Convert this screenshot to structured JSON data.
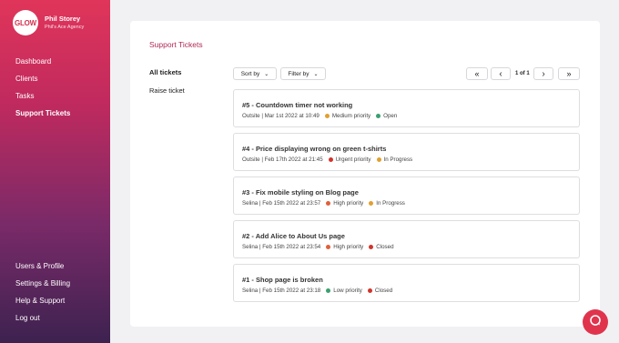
{
  "brand": {
    "logo_text": "GLOW",
    "user_name": "Phil Storey",
    "agency": "Phil's Ace Agency"
  },
  "nav_top": [
    {
      "label": "Dashboard"
    },
    {
      "label": "Clients"
    },
    {
      "label": "Tasks"
    },
    {
      "label": "Support Tickets",
      "active": true
    }
  ],
  "nav_bottom": [
    {
      "label": "Users & Profile"
    },
    {
      "label": "Settings & Billing"
    },
    {
      "label": "Help & Support"
    },
    {
      "label": "Log out"
    }
  ],
  "main": {
    "title": "Support Tickets",
    "subnav": [
      {
        "label": "All tickets",
        "active": true
      },
      {
        "label": "Raise ticket"
      }
    ],
    "sort_label": "Sort by",
    "filter_label": "Filter by",
    "pager": {
      "first": "«",
      "prev": "‹",
      "page_text": "1 of 1",
      "next": "›",
      "last": "»"
    },
    "tickets": [
      {
        "title": "#5 - Countdown timer not working",
        "meta": "Outsite | Mar 1st 2022 at 10:49",
        "priority": "Medium priority",
        "priority_color": "#e0a030",
        "status": "Open",
        "status_color": "#3aa070"
      },
      {
        "title": "#4 - Price displaying wrong on green t-shirts",
        "meta": "Outsite | Feb 17th 2022 at 21:45",
        "priority": "Urgent priority",
        "priority_color": "#d0342c",
        "status": "In Progress",
        "status_color": "#e0a030"
      },
      {
        "title": "#3 - Fix mobile styling on Blog page",
        "meta": "Selina | Feb 15th 2022 at 23:57",
        "priority": "High priority",
        "priority_color": "#e0603a",
        "status": "In Progress",
        "status_color": "#e0a030"
      },
      {
        "title": "#2 - Add Alice to About Us page",
        "meta": "Selina | Feb 15th 2022 at 23:54",
        "priority": "High priority",
        "priority_color": "#e0603a",
        "status": "Closed",
        "status_color": "#d0342c"
      },
      {
        "title": "#1 - Shop page is broken",
        "meta": "Selina | Feb 15th 2022 at 23:18",
        "priority": "Low priority",
        "priority_color": "#3aa070",
        "status": "Closed",
        "status_color": "#d0342c"
      }
    ]
  },
  "chat": {
    "icon": "chat-icon",
    "color": "#e0344c"
  }
}
